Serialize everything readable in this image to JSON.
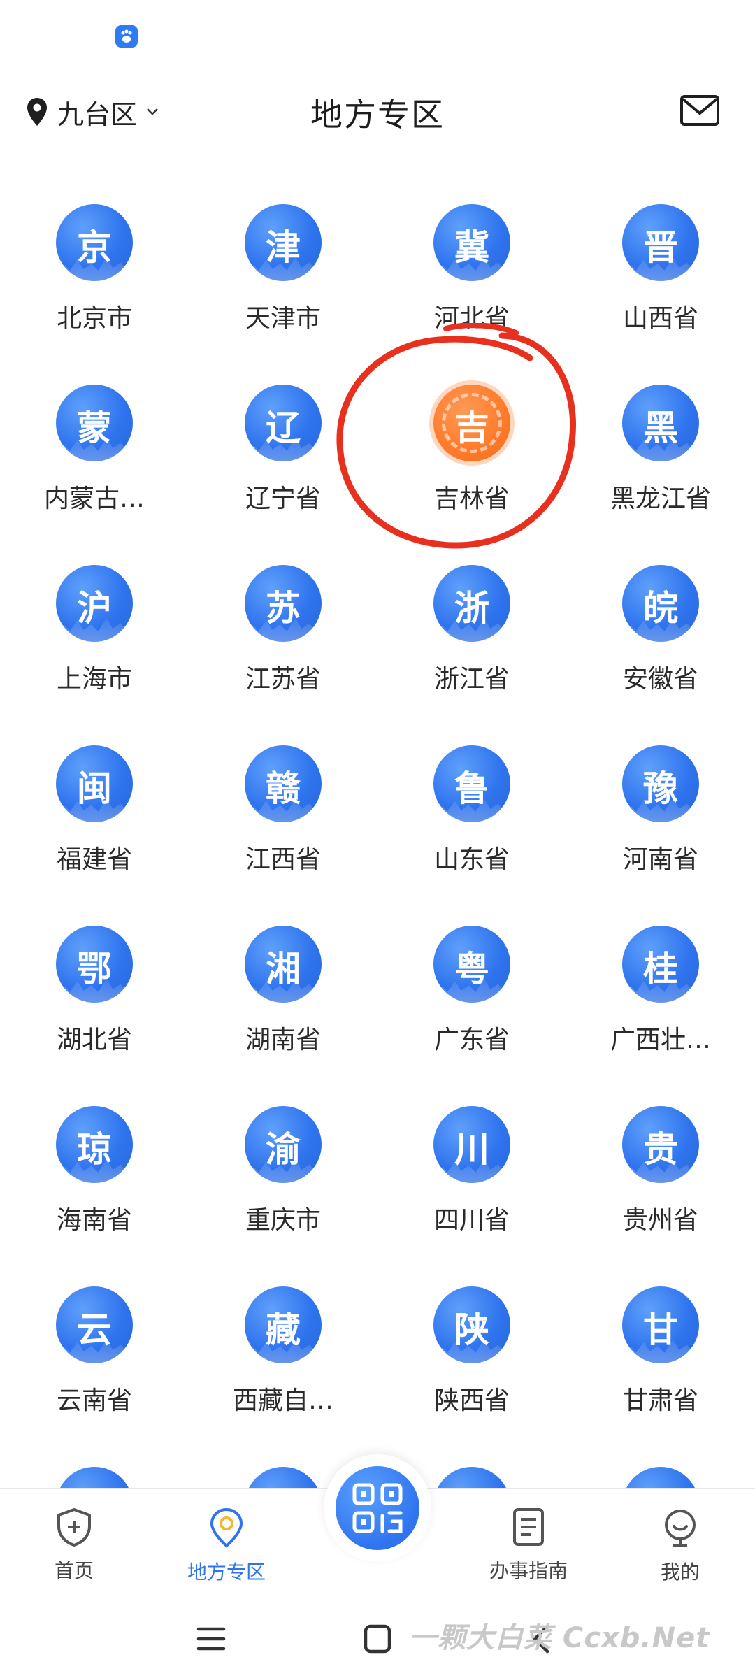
{
  "header": {
    "location": "九台区",
    "title": "地方专区"
  },
  "regions": [
    {
      "glyph": "京",
      "label": "北京市"
    },
    {
      "glyph": "津",
      "label": "天津市"
    },
    {
      "glyph": "冀",
      "label": "河北省"
    },
    {
      "glyph": "晋",
      "label": "山西省"
    },
    {
      "glyph": "蒙",
      "label": "内蒙古…"
    },
    {
      "glyph": "辽",
      "label": "辽宁省"
    },
    {
      "glyph": "吉",
      "label": "吉林省",
      "selected": true
    },
    {
      "glyph": "黑",
      "label": "黑龙江省"
    },
    {
      "glyph": "沪",
      "label": "上海市"
    },
    {
      "glyph": "苏",
      "label": "江苏省"
    },
    {
      "glyph": "浙",
      "label": "浙江省"
    },
    {
      "glyph": "皖",
      "label": "安徽省"
    },
    {
      "glyph": "闽",
      "label": "福建省"
    },
    {
      "glyph": "赣",
      "label": "江西省"
    },
    {
      "glyph": "鲁",
      "label": "山东省"
    },
    {
      "glyph": "豫",
      "label": "河南省"
    },
    {
      "glyph": "鄂",
      "label": "湖北省"
    },
    {
      "glyph": "湘",
      "label": "湖南省"
    },
    {
      "glyph": "粤",
      "label": "广东省"
    },
    {
      "glyph": "桂",
      "label": "广西壮…"
    },
    {
      "glyph": "琼",
      "label": "海南省"
    },
    {
      "glyph": "渝",
      "label": "重庆市"
    },
    {
      "glyph": "川",
      "label": "四川省"
    },
    {
      "glyph": "贵",
      "label": "贵州省"
    },
    {
      "glyph": "云",
      "label": "云南省"
    },
    {
      "glyph": "藏",
      "label": "西藏自…"
    },
    {
      "glyph": "陕",
      "label": "陕西省"
    },
    {
      "glyph": "甘",
      "label": "甘肃省"
    },
    {
      "glyph": "",
      "label": ""
    },
    {
      "glyph": "",
      "label": ""
    },
    {
      "glyph": "",
      "label": ""
    },
    {
      "glyph": "",
      "label": ""
    }
  ],
  "bottom_nav": {
    "home": "首页",
    "local": "地方专区",
    "guide": "办事指南",
    "mine": "我的"
  },
  "watermark": "一颗大白菜 Ccxb.Net",
  "colors": {
    "accent": "#2f74ee",
    "selected": "#ff7a2a",
    "annotation": "#e8301e"
  },
  "icons": {
    "location": "location-pin-icon",
    "mail": "mail-icon",
    "scan": "qr-scan-icon"
  }
}
